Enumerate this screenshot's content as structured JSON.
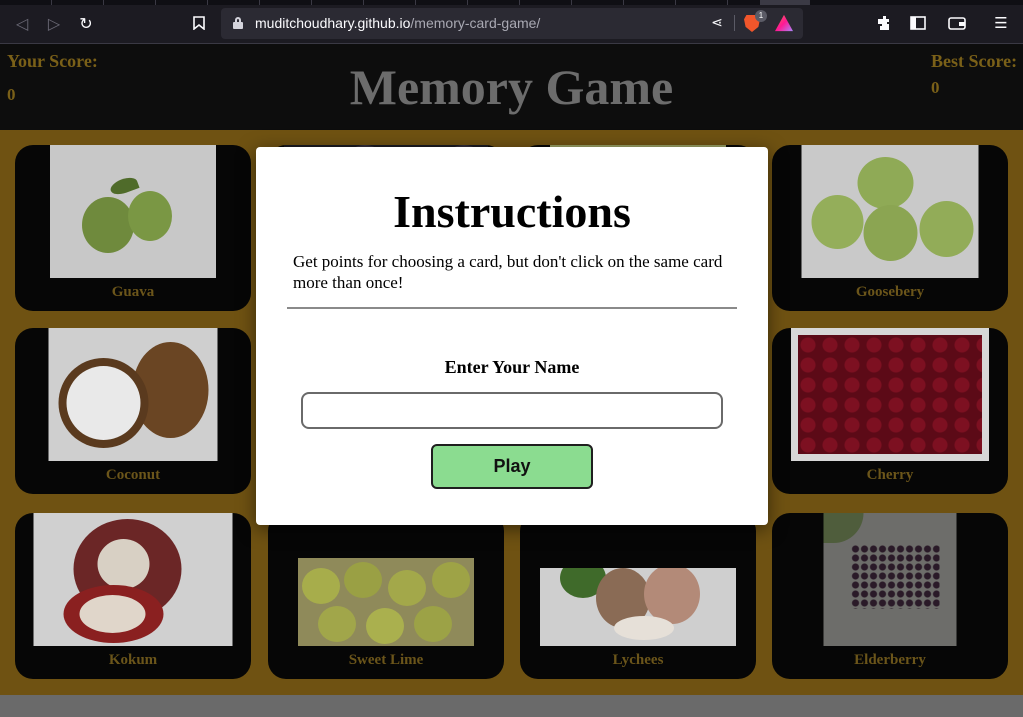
{
  "browser": {
    "url_domain": "muditchoudhary.github.io",
    "url_path": "/memory-card-game/",
    "brave_badge": "1"
  },
  "header": {
    "your_score_label": "Your Score:",
    "your_score_value": "0",
    "best_score_label": "Best Score:",
    "best_score_value": "0",
    "title": "Memory Game"
  },
  "cards": [
    {
      "name": "Guava"
    },
    {
      "name": ""
    },
    {
      "name": ""
    },
    {
      "name": "Goosebery"
    },
    {
      "name": "Coconut"
    },
    {
      "name": ""
    },
    {
      "name": ""
    },
    {
      "name": "Cherry"
    },
    {
      "name": "Kokum"
    },
    {
      "name": "Sweet Lime"
    },
    {
      "name": "Lychees"
    },
    {
      "name": "Elderberry"
    }
  ],
  "modal": {
    "title": "Instructions",
    "description": "Get points for choosing a card, but don't click on the same card more than once!",
    "name_label": "Enter Your Name",
    "name_value": "",
    "play_label": "Play"
  },
  "colors": {
    "page_bg": "#6f5212",
    "card_bg": "#060606",
    "play_button": "#8bdc90"
  }
}
